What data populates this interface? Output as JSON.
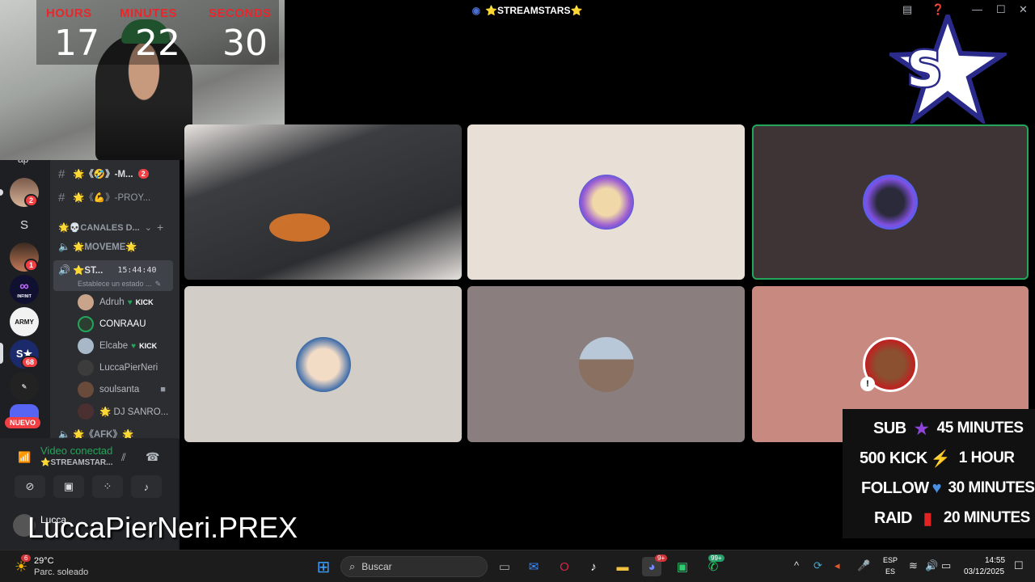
{
  "window": {
    "title": "⭐STREAMSTARS⭐"
  },
  "timer": {
    "labels": [
      "HOURS",
      "MINUTES",
      "SECONDS"
    ],
    "values": [
      "17",
      "22",
      "30"
    ]
  },
  "sidebar": {
    "channels": [
      {
        "name": "🌟《🤣》-M...",
        "badge": "2"
      },
      {
        "name": "🌟《💪》-PROY..."
      }
    ],
    "category": "🌟💀CANALES D...",
    "voice_channels": [
      {
        "name": "🌟MOVEME🌟"
      },
      {
        "name": "⭐ST...",
        "time": "15:44:40",
        "status": "Establece un estado ..."
      }
    ],
    "voice_users": [
      {
        "name": "Adruh",
        "tag": "KICK"
      },
      {
        "name": "CONRAAU"
      },
      {
        "name": "Elcabe",
        "tag": "KICK"
      },
      {
        "name": "LuccaPierNeri"
      },
      {
        "name": "soulsanta"
      },
      {
        "name": "🌟 DJ SANRO..."
      }
    ],
    "partial_channel": "🌟《AFK》🌟",
    "server_letter": "S",
    "server_badges": [
      "2",
      "1",
      "68"
    ],
    "server_label_army": "ARMY",
    "server_label_infinit": "INFINIT",
    "nuevo": "NUEVO",
    "header_partial": "ap"
  },
  "voice_panel": {
    "status": "Video conectad",
    "channel": "⭐STREAMSTAR...",
    "user": "Lucca"
  },
  "overlay": {
    "nickname": "LuccaPierNeri.PREX"
  },
  "goals": [
    {
      "key": "SUB",
      "icon": "★",
      "icon_color": "#8e44d9",
      "value": "45 MINUTES"
    },
    {
      "key": "500 KICK",
      "icon": "⚡",
      "icon_color": "#f5c518",
      "value": "1 HOUR"
    },
    {
      "key": "FOLLOW",
      "icon": "💙",
      "icon_color": "#4a90e2",
      "value": "30 MINUTES"
    },
    {
      "key": "RAID",
      "icon": "🔖",
      "icon_color": "#e02424",
      "value": "20 MINUTES"
    }
  ],
  "taskbar": {
    "weather_temp": "29°C",
    "weather_desc": "Parc. soleado",
    "weather_badge": "6",
    "search_placeholder": "Buscar",
    "discord_badge": "9+",
    "whatsapp_badge": "99+",
    "lang_top": "ESP",
    "lang_bottom": "ES",
    "time": "14:55",
    "date": "03/12/2025"
  },
  "colors": {
    "speaking_border": "#23a55a",
    "timer_label": "#e8262b",
    "discord_bg": "#2b2d31"
  }
}
